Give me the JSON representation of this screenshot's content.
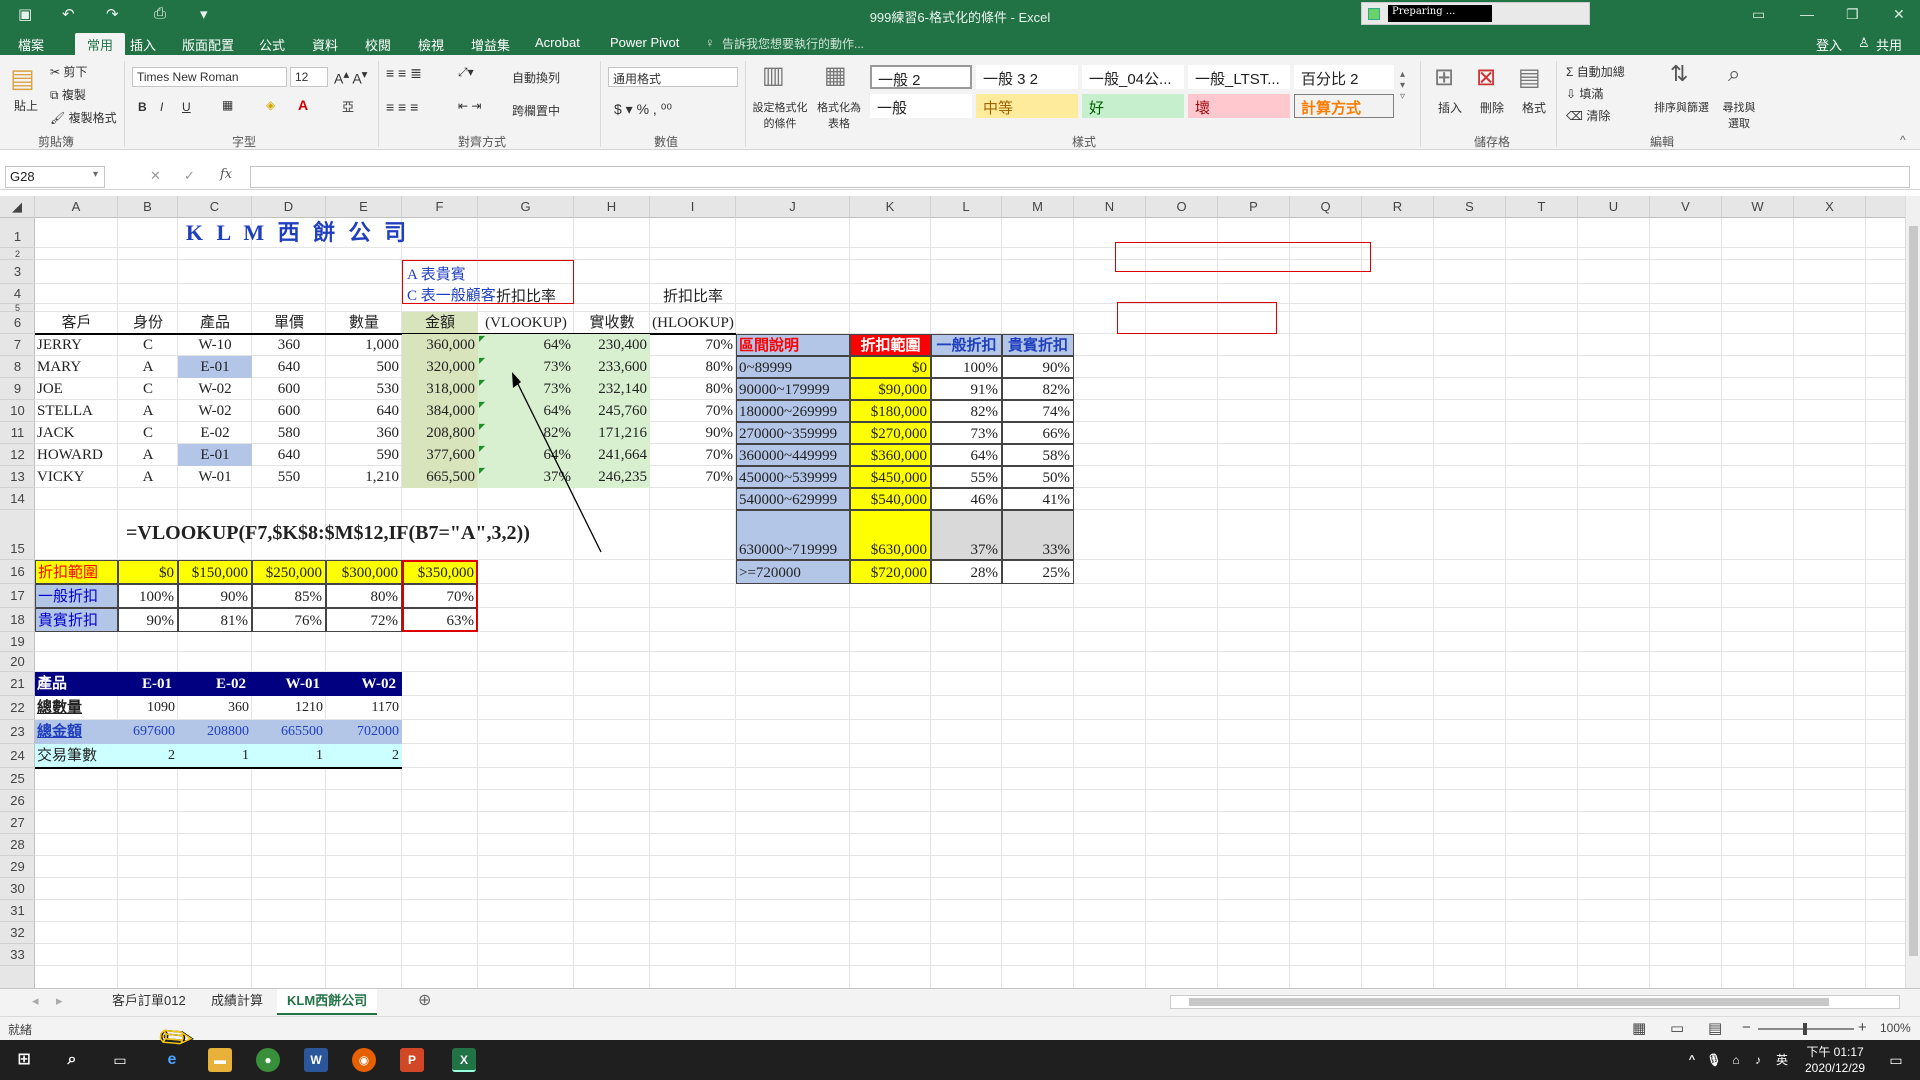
{
  "window": {
    "title": "999練習6-格式化的條件 - Excel",
    "status_badge": "Preparing ...",
    "login": "登入",
    "share": "共用"
  },
  "ribbon_tabs": [
    "檔案",
    "常用",
    "插入",
    "版面配置",
    "公式",
    "資料",
    "校閱",
    "檢視",
    "增益集",
    "Acrobat",
    "Power Pivot"
  ],
  "tell_me": "告訴我您想要執行的動作...",
  "ribbon": {
    "clipboard": {
      "paste": "貼上",
      "cut": "剪下",
      "copy": "複製",
      "format_painter": "複製格式",
      "group": "剪貼簿"
    },
    "font": {
      "name": "Times New Roman",
      "size": "12",
      "group": "字型"
    },
    "alignment": {
      "wrap": "自動換列",
      "merge": "跨欄置中",
      "group": "對齊方式"
    },
    "number": {
      "format": "通用格式",
      "group": "數值"
    },
    "styles": {
      "cond_format": "設定格式化的條件",
      "as_table": "格式化為表格",
      "group": "樣式",
      "cells": [
        "一般 2",
        "一般 3 2",
        "一般_04公...",
        "一般_LTST...",
        "百分比 2",
        "一般",
        "中等",
        "好",
        "壞",
        "計算方式"
      ]
    },
    "cells_group": {
      "insert": "插入",
      "delete": "刪除",
      "format": "格式",
      "group": "儲存格"
    },
    "editing": {
      "autosum": "自動加總",
      "fill": "填滿",
      "clear": "清除",
      "sort": "排序與篩選",
      "find": "尋找與選取",
      "group": "編輯"
    }
  },
  "formula_bar": {
    "name_box": "G28",
    "formula": ""
  },
  "columns": [
    "A",
    "B",
    "C",
    "D",
    "E",
    "F",
    "G",
    "H",
    "I",
    "J",
    "K",
    "L",
    "M",
    "N",
    "O",
    "P",
    "Q",
    "R",
    "S",
    "T",
    "U",
    "V",
    "W",
    "X"
  ],
  "rows": [
    "1",
    "2",
    "3",
    "4",
    "5",
    "6",
    "7",
    "8",
    "9",
    "10",
    "11",
    "12",
    "13",
    "14",
    "15",
    "16",
    "17",
    "18",
    "19",
    "20",
    "21",
    "22",
    "23",
    "24",
    "25",
    "26",
    "27",
    "28",
    "29",
    "30",
    "31",
    "32",
    "33"
  ],
  "sheet": {
    "title": "K L M 西 餅 公 司",
    "legend": [
      "A  表貴賓",
      "C  表一般顧客"
    ],
    "headers": {
      "customer": "客戶",
      "identity": "身份",
      "product": "產品",
      "price": "單價",
      "qty": "數量",
      "amount": "金額",
      "rate_v_1": "折扣比率",
      "rate_v_2": "(VLOOKUP)",
      "paid": "實收數",
      "rate_h_1": "折扣比率",
      "rate_h_2": "(HLOOKUP)"
    },
    "orders": [
      {
        "name": "JERRY",
        "id": "C",
        "product": "W-10",
        "price": "360",
        "qty": "1,000",
        "amount": "360,000",
        "rate_v": "64%",
        "paid": "230,400",
        "rate_h": "70%"
      },
      {
        "name": "MARY",
        "id": "A",
        "product": "E-01",
        "price": "640",
        "qty": "500",
        "amount": "320,000",
        "rate_v": "73%",
        "paid": "233,600",
        "rate_h": "80%"
      },
      {
        "name": "JOE",
        "id": "C",
        "product": "W-02",
        "price": "600",
        "qty": "530",
        "amount": "318,000",
        "rate_v": "73%",
        "paid": "232,140",
        "rate_h": "80%"
      },
      {
        "name": "STELLA",
        "id": "A",
        "product": "W-02",
        "price": "600",
        "qty": "640",
        "amount": "384,000",
        "rate_v": "64%",
        "paid": "245,760",
        "rate_h": "70%"
      },
      {
        "name": "JACK",
        "id": "C",
        "product": "E-02",
        "price": "580",
        "qty": "360",
        "amount": "208,800",
        "rate_v": "82%",
        "paid": "171,216",
        "rate_h": "90%"
      },
      {
        "name": "HOWARD",
        "id": "A",
        "product": "E-01",
        "price": "640",
        "qty": "590",
        "amount": "377,600",
        "rate_v": "64%",
        "paid": "241,664",
        "rate_h": "70%"
      },
      {
        "name": "VICKY",
        "id": "A",
        "product": "W-01",
        "price": "550",
        "qty": "1,210",
        "amount": "665,500",
        "rate_v": "37%",
        "paid": "246,235",
        "rate_h": "70%"
      }
    ],
    "formula_note": "=VLOOKUP(F7,$K$8:$M$12,IF(B7=\"A\",3,2))",
    "htable": {
      "labels": [
        "折扣範圍",
        "一般折扣",
        "貴賓折扣"
      ],
      "range": [
        "$0",
        "$150,000",
        "$250,000",
        "$300,000",
        "$350,000"
      ],
      "normal": [
        "100%",
        "90%",
        "85%",
        "80%",
        "70%"
      ],
      "vip": [
        "90%",
        "81%",
        "76%",
        "72%",
        "63%"
      ]
    },
    "summary": {
      "headers": [
        "產品",
        "E-01",
        "E-02",
        "W-01",
        "W-02"
      ],
      "rows": [
        {
          "label": "總數量",
          "values": [
            "1090",
            "360",
            "1210",
            "1170"
          ]
        },
        {
          "label": "總金額",
          "values": [
            "697600",
            "208800",
            "665500",
            "702000"
          ]
        },
        {
          "label": "交易筆數",
          "values": [
            "2",
            "1",
            "1",
            "2"
          ]
        }
      ]
    },
    "vtable": {
      "headers": [
        "區間說明",
        "折扣範圍",
        "一般折扣",
        "貴賓折扣"
      ],
      "rows": [
        {
          "desc": "0~89999",
          "range": "$0",
          "normal": "100%",
          "vip": "90%"
        },
        {
          "desc": "90000~179999",
          "range": "$90,000",
          "normal": "91%",
          "vip": "82%"
        },
        {
          "desc": "180000~269999",
          "range": "$180,000",
          "normal": "82%",
          "vip": "74%"
        },
        {
          "desc": "270000~359999",
          "range": "$270,000",
          "normal": "73%",
          "vip": "66%"
        },
        {
          "desc": "360000~449999",
          "range": "$360,000",
          "normal": "64%",
          "vip": "58%"
        },
        {
          "desc": "450000~539999",
          "range": "$450,000",
          "normal": "55%",
          "vip": "50%"
        },
        {
          "desc": "540000~629999",
          "range": "$540,000",
          "normal": "46%",
          "vip": "41%"
        },
        {
          "desc": "630000~719999",
          "range": "$630,000",
          "normal": "37%",
          "vip": "33%"
        },
        {
          "desc": ">=720000",
          "range": "$720,000",
          "normal": "28%",
          "vip": "25%"
        }
      ]
    }
  },
  "sheet_tabs": [
    "客戶訂單012",
    "成績計算",
    "KLM西餅公司"
  ],
  "status": {
    "ready": "就緒",
    "zoom": "100%"
  },
  "taskbar": {
    "time": "下午 01:17",
    "date": "2020/12/29",
    "ime": "英"
  },
  "colors": {
    "excel_green": "#217346",
    "yellow": "#ffff00",
    "light_blue": "#b4c6e7",
    "navy": "#000080",
    "cyan": "#ccffff",
    "green_fill": "#d8e4bc",
    "red_text": "#ff0000"
  }
}
